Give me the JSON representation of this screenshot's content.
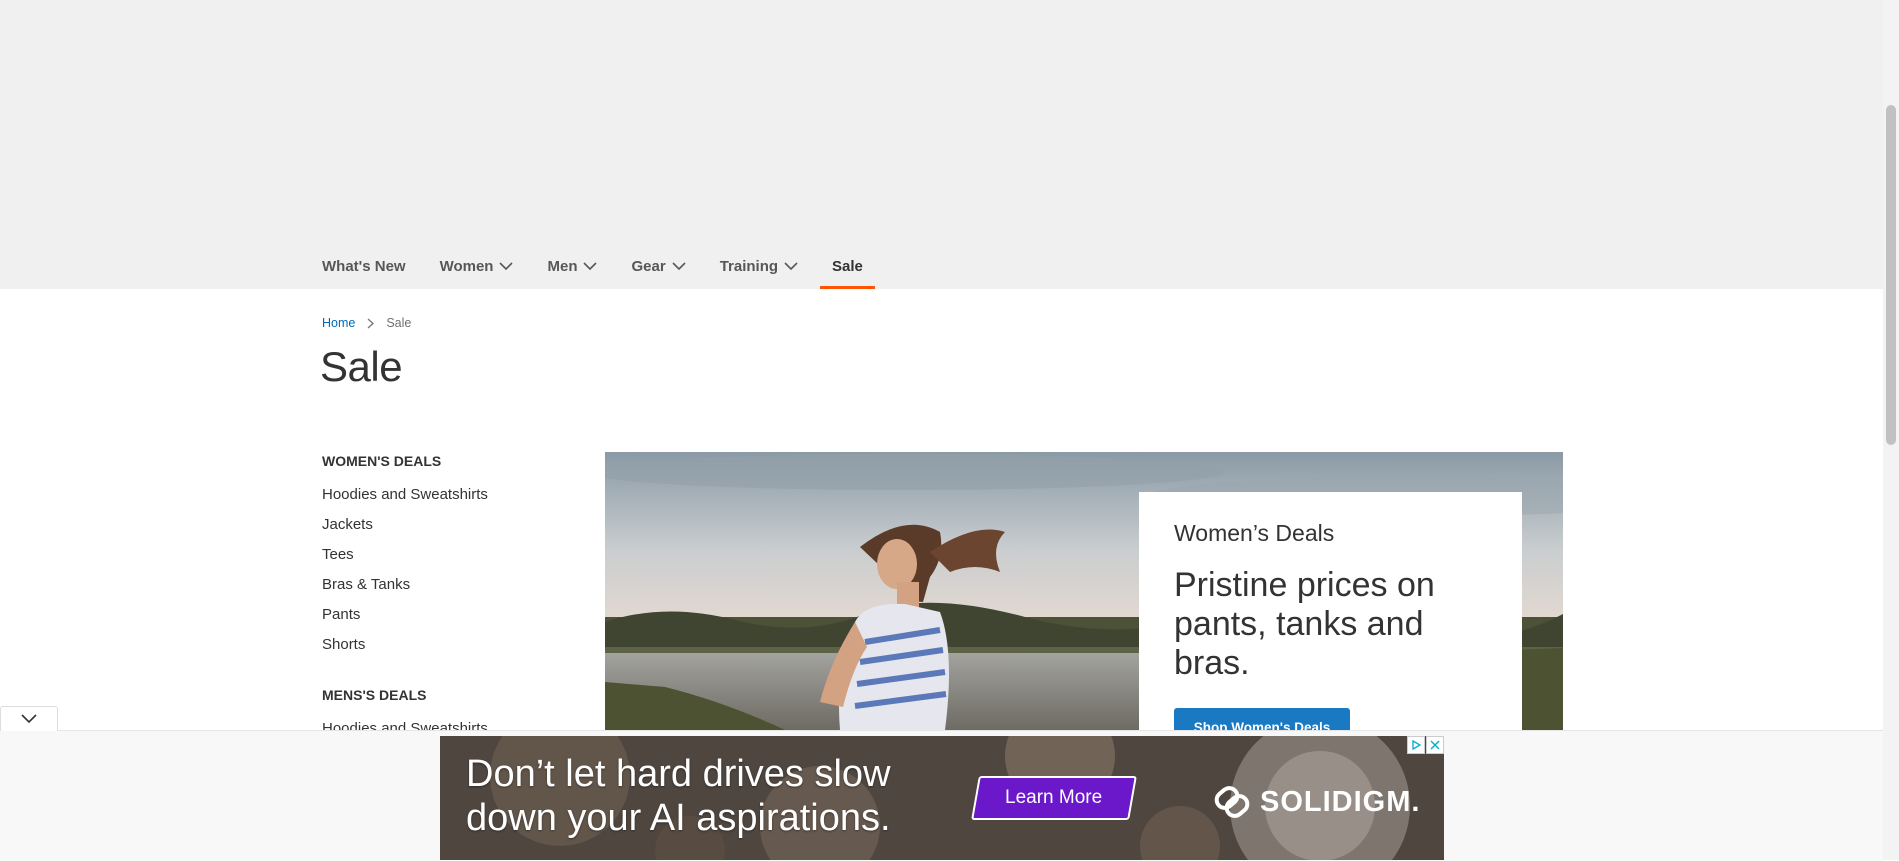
{
  "nav": {
    "items": [
      {
        "label": "What's New",
        "has_menu": false
      },
      {
        "label": "Women",
        "has_menu": true
      },
      {
        "label": "Men",
        "has_menu": true
      },
      {
        "label": "Gear",
        "has_menu": true
      },
      {
        "label": "Training",
        "has_menu": true
      },
      {
        "label": "Sale",
        "has_menu": false,
        "active": true
      }
    ],
    "accent_color": "#ff5501"
  },
  "breadcrumb": {
    "home": "Home",
    "current": "Sale"
  },
  "page_title": "Sale",
  "sidebar": {
    "womens_heading": "WOMEN'S DEALS",
    "womens_links": [
      "Hoodies and Sweatshirts",
      "Jackets",
      "Tees",
      "Bras & Tanks",
      "Pants",
      "Shorts"
    ],
    "mens_heading": "MENS'S DEALS",
    "mens_links": [
      "Hoodies and Sweatshirts"
    ]
  },
  "promo": {
    "label": "Women’s Deals",
    "text": "Pristine prices on pants, tanks and bras.",
    "button": "Shop Women's Deals",
    "button_color": "#1979c3"
  },
  "ad": {
    "headline_line1": "Don’t let hard drives slow",
    "headline_line2": "down your AI aspirations.",
    "cta": "Learn More",
    "brand": "SOLIDIGM."
  }
}
